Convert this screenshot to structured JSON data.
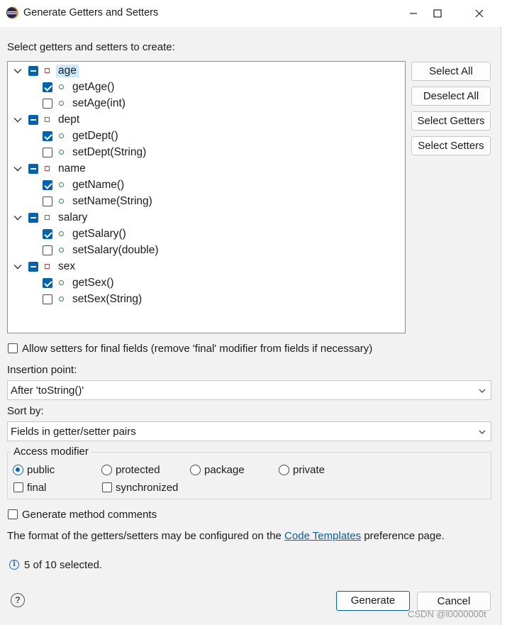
{
  "window": {
    "title": "Generate Getters and Setters",
    "accent_color": "#0063b1"
  },
  "prompt": "Select getters and setters to create:",
  "tree": [
    {
      "field": "age",
      "methods": [
        {
          "label": "getAge()",
          "checked": true
        },
        {
          "label": "setAge(int)",
          "checked": false
        }
      ]
    },
    {
      "field": "dept",
      "methods": [
        {
          "label": "getDept()",
          "checked": true
        },
        {
          "label": "setDept(String)",
          "checked": false
        }
      ]
    },
    {
      "field": "name",
      "methods": [
        {
          "label": "getName()",
          "checked": true
        },
        {
          "label": "setName(String)",
          "checked": false
        }
      ]
    },
    {
      "field": "salary",
      "methods": [
        {
          "label": "getSalary()",
          "checked": true
        },
        {
          "label": "setSalary(double)",
          "checked": false
        }
      ]
    },
    {
      "field": "sex",
      "methods": [
        {
          "label": "getSex()",
          "checked": true
        },
        {
          "label": "setSex(String)",
          "checked": false
        }
      ]
    }
  ],
  "side_buttons": {
    "select_all": "Select All",
    "deselect_all": "Deselect All",
    "select_getters": "Select Getters",
    "select_setters": "Select Setters"
  },
  "allow_final": "Allow setters for final fields (remove 'final' modifier from fields if necessary)",
  "insertion": {
    "label": "Insertion point:",
    "value": "After 'toString()'"
  },
  "sort": {
    "label": "Sort by:",
    "value": "Fields in getter/setter pairs"
  },
  "access": {
    "title": "Access modifier",
    "options": [
      "public",
      "protected",
      "package",
      "private"
    ],
    "selected": "public",
    "final_label": "final",
    "synchronized_label": "synchronized"
  },
  "comments_label": "Generate method comments",
  "format": {
    "before": "The format of the getters/setters may be configured on the ",
    "link": "Code Templates",
    "after": " preference page."
  },
  "status": "5 of 10 selected.",
  "footer": {
    "generate": "Generate",
    "cancel": "Cancel"
  },
  "watermark": "CSDN @l0000000t"
}
